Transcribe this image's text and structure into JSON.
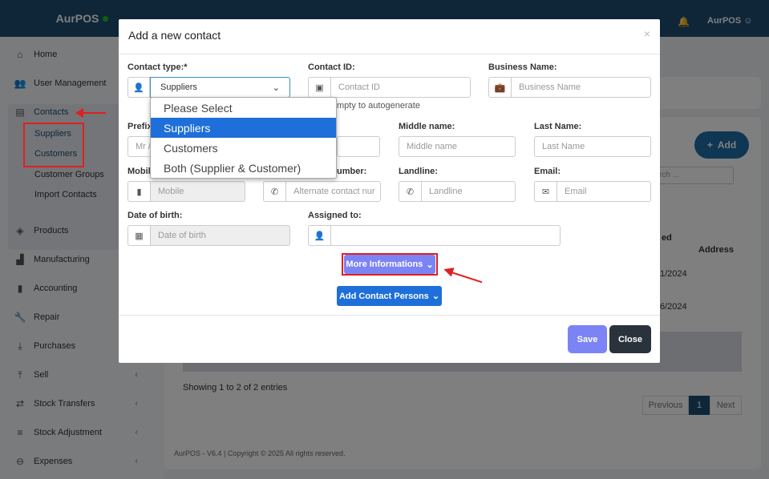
{
  "app": {
    "name": "AurPOS",
    "user": "AurPOS"
  },
  "sidebar": {
    "items": [
      {
        "label": "Home",
        "icon": "home-icon"
      },
      {
        "label": "User Management",
        "icon": "users-icon"
      },
      {
        "label": "Contacts",
        "icon": "address-book-icon"
      },
      {
        "label": "Products",
        "icon": "cube-icon"
      },
      {
        "label": "Manufacturing",
        "icon": "industry-icon"
      },
      {
        "label": "Accounting",
        "icon": "book-icon"
      },
      {
        "label": "Repair",
        "icon": "wrench-icon"
      },
      {
        "label": "Purchases",
        "icon": "download-icon"
      },
      {
        "label": "Sell",
        "icon": "upload-icon"
      },
      {
        "label": "Stock Transfers",
        "icon": "truck-icon"
      },
      {
        "label": "Stock Adjustment",
        "icon": "database-icon"
      },
      {
        "label": "Expenses",
        "icon": "minus-circle-icon"
      }
    ],
    "contacts_sub": [
      "Suppliers",
      "Customers",
      "Customer Groups",
      "Import Contacts"
    ]
  },
  "background": {
    "add_button": "Add",
    "search_placeholder": "rch ...",
    "col_added": "ed",
    "col_address": "Address",
    "row1_date": "1/2024",
    "row2_date": "6/2024",
    "showing": "Showing 1 to 2 of 2 entries",
    "pager": {
      "prev": "Previous",
      "page": "1",
      "next": "Next"
    },
    "footer": "AurPOS - V6.4 | Copyright © 2025 All rights reserved."
  },
  "modal": {
    "title": "Add a new contact",
    "close_x": "×",
    "contact_type_label": "Contact type:*",
    "contact_type_value": "Suppliers",
    "contact_id_label": "Contact ID:",
    "contact_id_placeholder": "Contact ID",
    "contact_id_help": "mpty to autogenerate",
    "business_name_label": "Business Name:",
    "business_name_placeholder": "Business Name",
    "prefix_label": "Prefix",
    "prefix_placeholder": "Mr /",
    "middle_name_label": "Middle name:",
    "middle_name_placeholder": "Middle name",
    "last_name_label": "Last Name:",
    "last_name_placeholder": "Last Name",
    "mobile_label": "Mobil",
    "mobile_placeholder": "Mobile",
    "alt_label": "umber:",
    "alt_placeholder": "Alternate contact nur",
    "landline_label": "Landline:",
    "landline_placeholder": "Landline",
    "email_label": "Email:",
    "email_placeholder": "Email",
    "dob_label": "Date of birth:",
    "dob_placeholder": "Date of birth",
    "assigned_label": "Assigned to:",
    "more_info_button": "More Informations",
    "add_persons_button": "Add Contact Persons",
    "save_button": "Save",
    "close_button": "Close",
    "dropdown_options": [
      "Please Select",
      "Suppliers",
      "Customers",
      "Both (Supplier & Customer)"
    ]
  },
  "colors": {
    "topbar": "#1e4d73",
    "primary": "#1e6fd9",
    "save": "#7b83f5",
    "close": "#2a323c",
    "annotation": "#e02020"
  }
}
